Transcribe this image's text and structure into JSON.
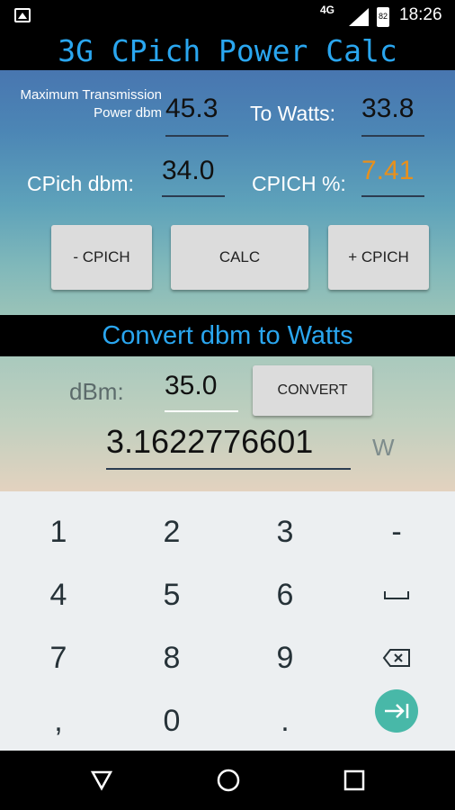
{
  "status_bar": {
    "network": "4G",
    "battery_level": "82",
    "time": "18:26"
  },
  "app": {
    "title": "3G CPich Power Calc"
  },
  "calc": {
    "max_power_label": "Maximum Transmission Power dbm",
    "max_power_value": "45.3",
    "to_watts_label": "To Watts:",
    "to_watts_value": "33.8",
    "cpich_dbm_label": "CPich dbm:",
    "cpich_dbm_value": "34.0",
    "cpich_pct_label": "CPICH %:",
    "cpich_pct_value": "7.41",
    "minus_button": "- CPICH",
    "calc_button": "CALC",
    "plus_button": "+ CPICH"
  },
  "convert": {
    "title": "Convert dbm to Watts",
    "dbm_label": "dBm:",
    "dbm_value": "35.0",
    "convert_button": "CONVERT",
    "result_value": "3.1622776601",
    "unit": "W"
  },
  "keypad": {
    "keys": [
      "1",
      "2",
      "3",
      "-",
      "4",
      "5",
      "6",
      "␣",
      "7",
      "8",
      "9",
      "⌫",
      ",",
      "0",
      ".",
      "⇥"
    ]
  },
  "colors": {
    "accent": "#2aa6ef",
    "highlight": "#e8901c",
    "enter": "#48b8a8"
  }
}
